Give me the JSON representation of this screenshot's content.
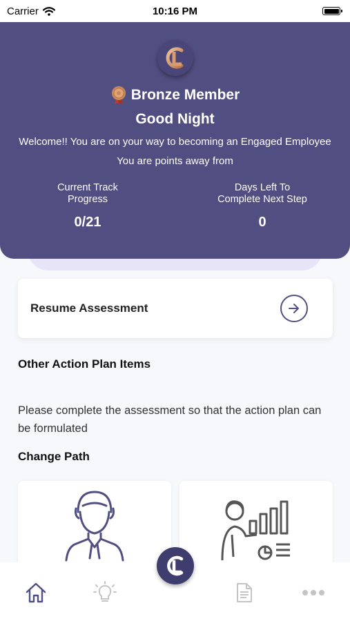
{
  "status_bar": {
    "carrier": "Carrier",
    "time": "10:16 PM"
  },
  "header": {
    "member_level": "Bronze Member",
    "greeting": "Good Night",
    "welcome": "Welcome!! You are on your way to becoming an Engaged Employee",
    "points_text": "You are points away from",
    "stats": [
      {
        "label_line1": "Current Track",
        "label_line2": "Progress",
        "value": "0/21"
      },
      {
        "label_line1": "Days Left To",
        "label_line2": "Complete Next Step",
        "value": "0"
      }
    ]
  },
  "resume": {
    "label": "Resume Assessment"
  },
  "action_plan": {
    "title": "Other Action Plan Items",
    "message": "Please complete the assessment so that the action plan can be formulated"
  },
  "change_path": {
    "title": "Change Path"
  },
  "icons": {
    "logo": "cl-logo-icon",
    "medal": "bronze-medal-icon",
    "arrow": "arrow-right-circle-icon",
    "tabs": [
      "home-icon",
      "lightbulb-icon",
      "document-icon",
      "more-dots-icon"
    ]
  },
  "colors": {
    "primary": "#514e81",
    "accent": "#c88a5a",
    "inactive_tab": "#c4c4c4",
    "background": "#f7f8fb"
  }
}
